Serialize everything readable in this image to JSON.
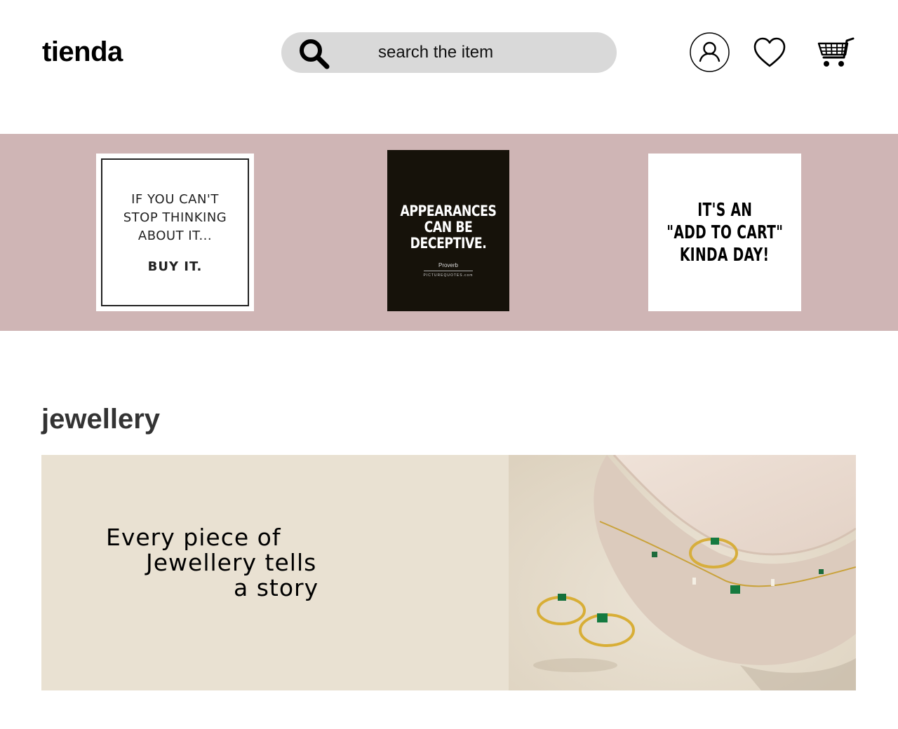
{
  "header": {
    "logo": "tienda",
    "search": {
      "placeholder": "search the item",
      "value": ""
    },
    "icons": [
      "user-icon",
      "heart-icon",
      "cart-icon"
    ]
  },
  "banner": {
    "background": "#cfb5b5",
    "quotes": [
      {
        "lines": [
          "IF YOU CAN'T STOP THINKING ABOUT IT..."
        ],
        "emphasis": "BUY IT."
      },
      {
        "lines": [
          "APPEARANCES",
          "CAN BE",
          "DECEPTIVE."
        ],
        "credit": "Proverb",
        "site": "PICTUREQUOTES.com"
      },
      {
        "lines": [
          "IT'S AN",
          "\"ADD TO CART\"",
          "KINDA DAY!"
        ]
      }
    ]
  },
  "jewellery": {
    "title": "jewellery",
    "tagline": [
      "Every piece of",
      "Jewellery tells",
      "a story"
    ],
    "colors": {
      "panel": "#e9e1d2"
    }
  }
}
